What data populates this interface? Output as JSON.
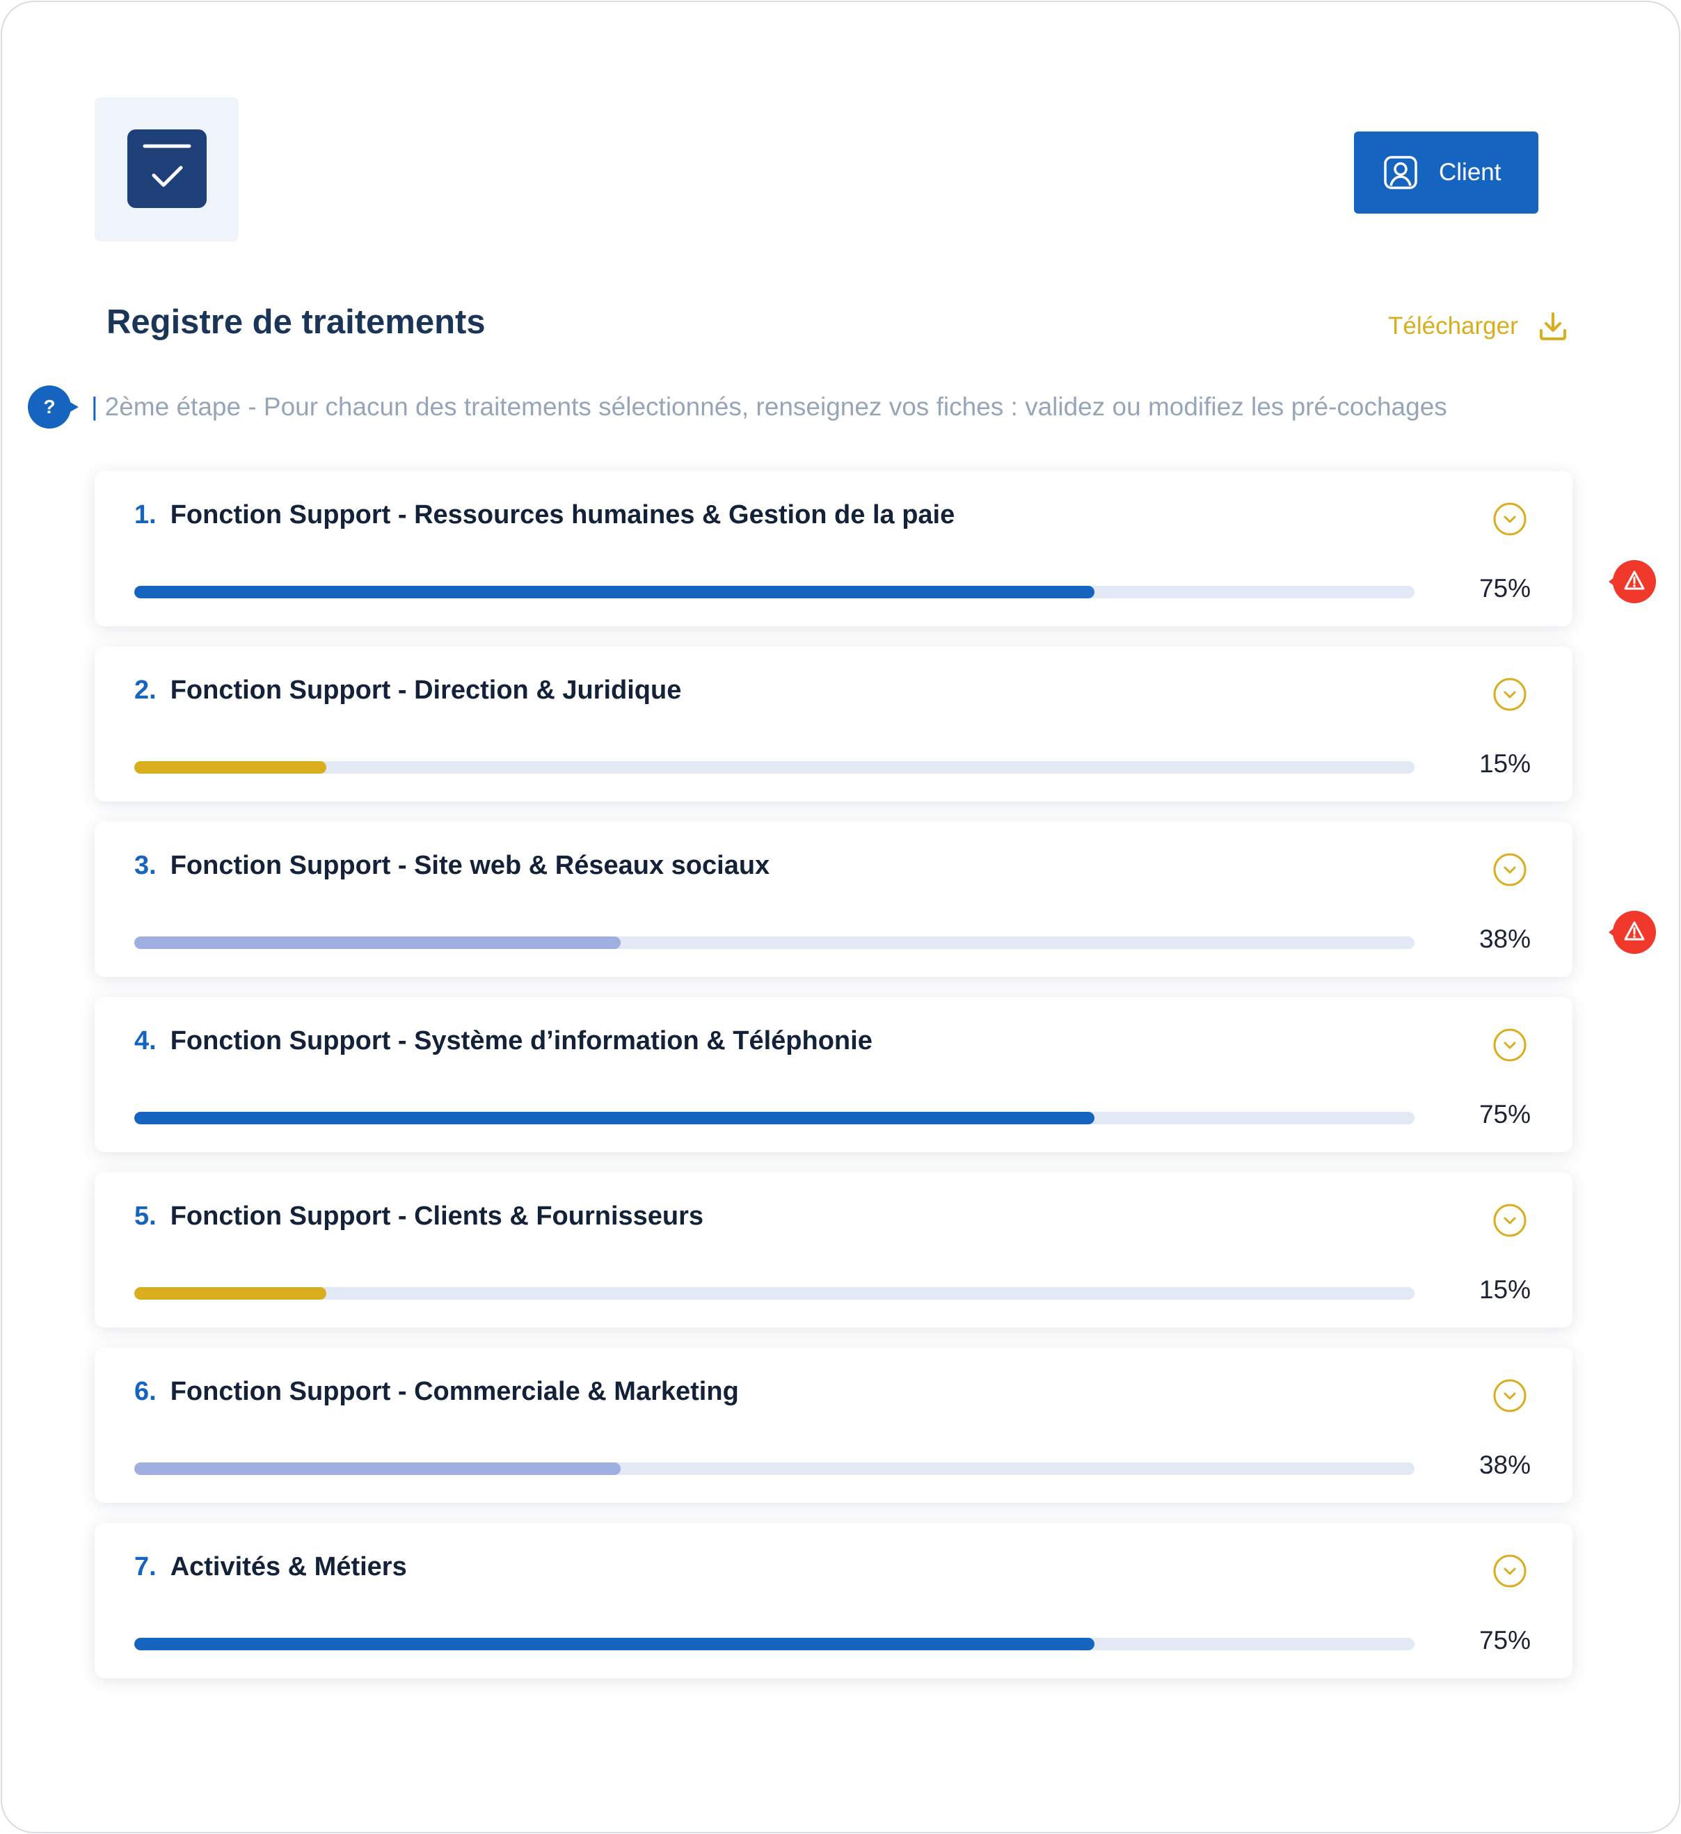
{
  "header": {
    "logo_icon": "checkbox-check-icon",
    "client_button": {
      "label": "Client",
      "icon": "user-profile-icon"
    }
  },
  "page": {
    "title": "Registre de traitements",
    "download": {
      "label": "Télécharger",
      "icon": "download-icon"
    },
    "help": {
      "glyph": "?"
    },
    "instruction": {
      "bar": "|",
      "text": "2ème étape - Pour chacun des traitements sélectionnés, renseignez vos fiches : validez ou modifiez les pré-cochages"
    }
  },
  "colors": {
    "primary": "#1565c0",
    "logo": "#1e3f78",
    "accent_gold": "#d8ae1e",
    "light_blue": "#9fb0e0",
    "track": "#e3e8f5",
    "warning": "#f0392b"
  },
  "treatments": [
    {
      "num": "1.",
      "label": "Fonction Support - Ressources humaines & Gestion de la paie",
      "progress": 75,
      "progress_text": "75%",
      "bar_color": "#1565c0",
      "warning": true
    },
    {
      "num": "2.",
      "label": "Fonction Support - Direction & Juridique",
      "progress": 15,
      "progress_text": "15%",
      "bar_color": "#d8ae1e",
      "warning": false
    },
    {
      "num": "3.",
      "label": "Fonction Support - Site web & Réseaux sociaux",
      "progress": 38,
      "progress_text": "38%",
      "bar_color": "#9fb0e0",
      "warning": true
    },
    {
      "num": "4.",
      "label": "Fonction Support - Système d’information & Téléphonie",
      "progress": 75,
      "progress_text": "75%",
      "bar_color": "#1565c0",
      "warning": false
    },
    {
      "num": "5.",
      "label": "Fonction Support - Clients & Fournisseurs",
      "progress": 15,
      "progress_text": "15%",
      "bar_color": "#d8ae1e",
      "warning": false
    },
    {
      "num": "6.",
      "label": "Fonction Support - Commerciale & Marketing",
      "progress": 38,
      "progress_text": "38%",
      "bar_color": "#9fb0e0",
      "warning": false
    },
    {
      "num": "7.",
      "label": "Activités & Métiers",
      "progress": 75,
      "progress_text": "75%",
      "bar_color": "#1565c0",
      "warning": false
    }
  ]
}
